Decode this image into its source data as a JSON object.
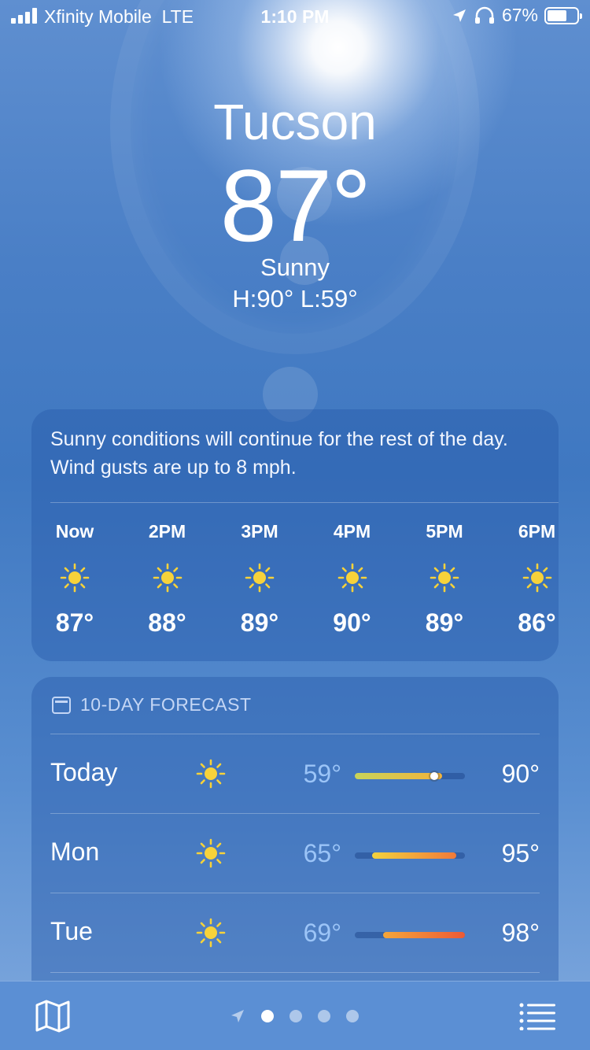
{
  "status_bar": {
    "carrier": "Xfinity Mobile",
    "network": "LTE",
    "time": "1:10 PM",
    "battery": "67%",
    "battery_level": 0.67
  },
  "location": {
    "city": "Tucson",
    "temperature": "87°",
    "condition": "Sunny",
    "high_low": "H:90°  L:59°"
  },
  "hourly": {
    "summary": "Sunny conditions will continue for the rest of the day. Wind gusts are up to 8 mph.",
    "hours": [
      {
        "label": "Now",
        "icon": "sun-icon",
        "temp": "87°"
      },
      {
        "label": "2PM",
        "icon": "sun-icon",
        "temp": "88°"
      },
      {
        "label": "3PM",
        "icon": "sun-icon",
        "temp": "89°"
      },
      {
        "label": "4PM",
        "icon": "sun-icon",
        "temp": "90°"
      },
      {
        "label": "5PM",
        "icon": "sun-icon",
        "temp": "89°"
      },
      {
        "label": "6PM",
        "icon": "sun-icon",
        "temp": "86°"
      }
    ]
  },
  "forecast": {
    "title": "10-DAY FORECAST",
    "icon": "calendar-icon",
    "scale_min": 59,
    "scale_max": 98,
    "days": [
      {
        "day": "Today",
        "icon": "sun-icon",
        "low": "59°",
        "high": "90°",
        "low_value": 59,
        "high_value": 90,
        "current_value": 87,
        "colors": [
          "#c8d45a",
          "#f2b33c"
        ]
      },
      {
        "day": "Mon",
        "icon": "sun-icon",
        "low": "65°",
        "high": "95°",
        "low_value": 65,
        "high_value": 95,
        "colors": [
          "#f3d23c",
          "#f07a3a"
        ]
      },
      {
        "day": "Tue",
        "icon": "sun-icon",
        "low": "69°",
        "high": "98°",
        "low_value": 69,
        "high_value": 98,
        "colors": [
          "#f5a63a",
          "#ec5a35"
        ]
      }
    ]
  },
  "toolbar": {
    "map_icon": "map-icon",
    "list_icon": "list-icon",
    "location_icon": "location-arrow-icon",
    "page_count": 4,
    "active_page": 0
  }
}
